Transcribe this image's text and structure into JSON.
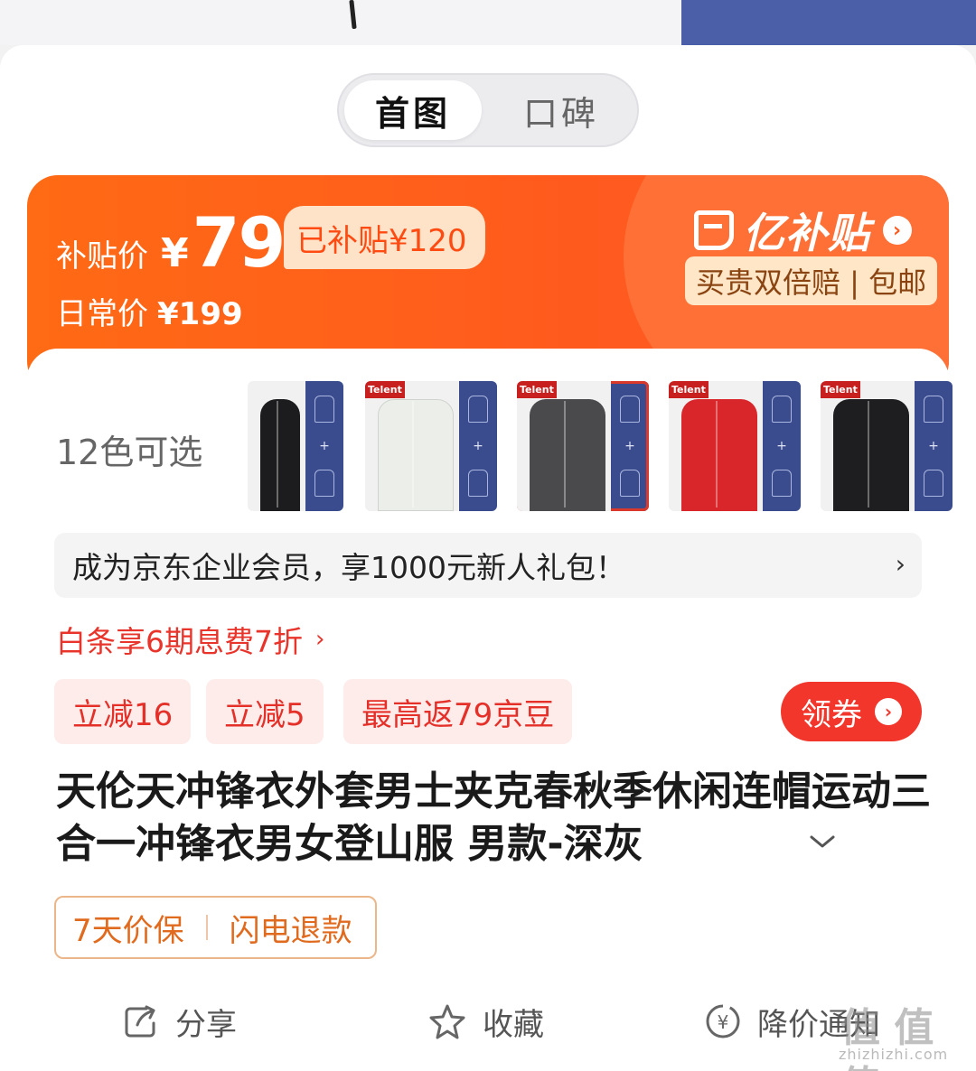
{
  "tabs": [
    {
      "label": "首图",
      "active": true
    },
    {
      "label": "口碑",
      "active": false
    }
  ],
  "price": {
    "subsidy_label": "补贴价",
    "currency": "¥",
    "subsidy_value": "79",
    "subsidy_badge": "已补贴¥120",
    "daily_label": "日常价",
    "daily_value": "¥199",
    "brand": "亿补贴",
    "promise": "买贵双倍赔 | 包邮"
  },
  "colors": {
    "label": "12色可选",
    "options": [
      {
        "color": "#1c1c1e",
        "tagged": false,
        "selected": false
      },
      {
        "color": "#ebeee9",
        "tagged": true,
        "tag": "Telent",
        "selected": false
      },
      {
        "color": "#4a4a4d",
        "tagged": true,
        "tag": "Telent",
        "selected": true
      },
      {
        "color": "#d9262b",
        "tagged": true,
        "tag": "Telent",
        "selected": false
      },
      {
        "color": "#1e1e20",
        "tagged": true,
        "tag": "Telent",
        "selected": false
      }
    ]
  },
  "member_bar": "成为京东企业会员，享1000元新人礼包！",
  "baitiao": "白条享6期息费7折",
  "chips": [
    "立减16",
    "立减5",
    "最高返79京豆"
  ],
  "coupon_button": "领券",
  "title": "天伦天冲锋衣外套男士夹克春秋季休闲连帽运动三合一冲锋衣男女登山服 男款-深灰",
  "services": [
    "7天价保",
    "闪电退款"
  ],
  "actions": [
    {
      "label": "分享",
      "icon": "share-icon"
    },
    {
      "label": "收藏",
      "icon": "star-icon"
    },
    {
      "label": "降价通知",
      "icon": "price-alert-icon"
    }
  ],
  "watermark": {
    "text": "值 值 值",
    "url": "zhizhizhi.com"
  }
}
